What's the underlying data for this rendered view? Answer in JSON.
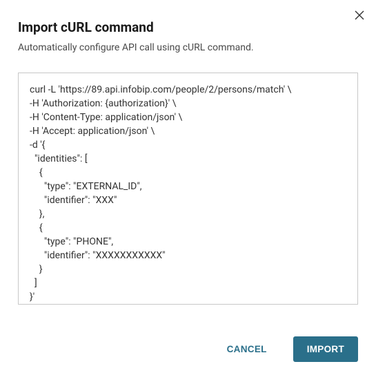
{
  "header": {
    "title": "Import cURL command",
    "subtitle": "Automatically configure API call using cURL command."
  },
  "curl_input": {
    "value": "curl -L 'https://89.api.infobip.com/people/2/persons/match' \\\n-H 'Authorization: {authorization}' \\\n-H 'Content-Type: application/json' \\\n-H 'Accept: application/json' \\\n-d '{\n  \"identities\": [\n    {\n      \"type\": \"EXTERNAL_ID\",\n      \"identifier\": \"XXX\"\n    },\n    {\n      \"type\": \"PHONE\",\n      \"identifier\": \"XXXXXXXXXXX\"\n    }\n  ]\n}'"
  },
  "footer": {
    "cancel_label": "CANCEL",
    "import_label": "IMPORT"
  }
}
